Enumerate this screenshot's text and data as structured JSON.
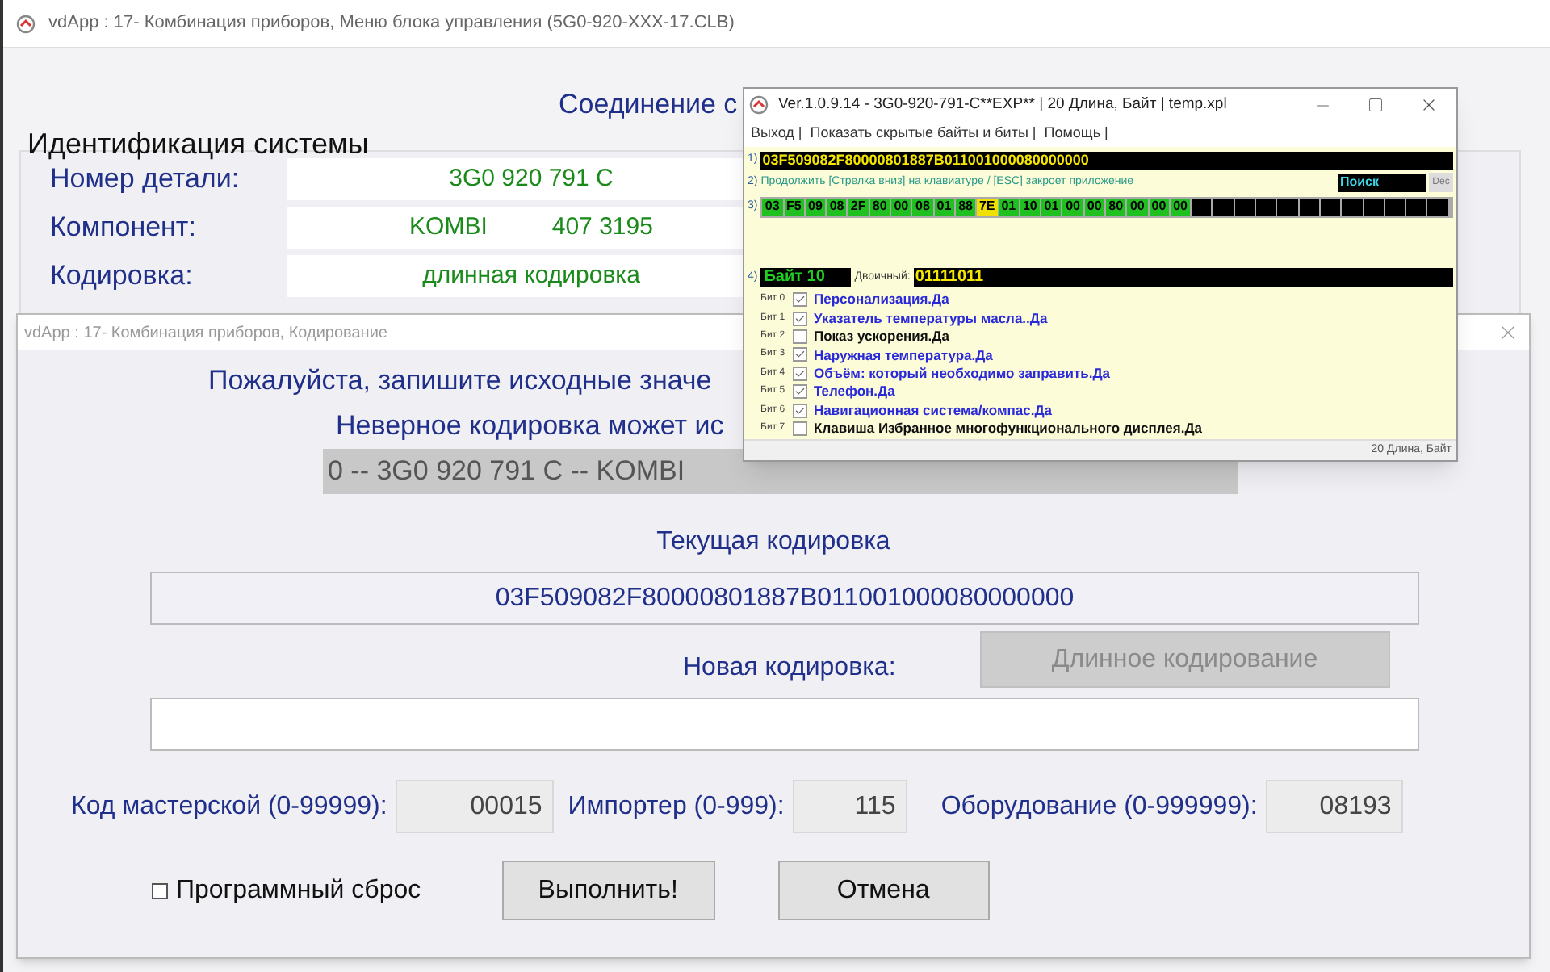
{
  "main_window": {
    "title": "vdApp : 17- Комбинация приборов,  Меню блока управления (5G0-920-XXX-17.CLB)",
    "connection_label": "Соединение с",
    "group_title": "Идентификация системы",
    "fields": [
      {
        "label": "Номер детали:",
        "values": [
          "3G0 920 791 C"
        ]
      },
      {
        "label": "Компонент:",
        "values": [
          "KOMBI",
          "407 3195"
        ]
      },
      {
        "label": "Кодировка:",
        "values": [
          "длинная кодировка"
        ]
      }
    ]
  },
  "coding_dialog": {
    "title": "vdApp : 17- Комбинация приборов,  Кодирование",
    "warning_1": "Пожалуйста, запишите исходные значе",
    "warning_2": "Неверное кодировка может ис",
    "identity": "0 -- 3G0 920 791 C -- KOMBI",
    "current_label": "Текущая кодировка",
    "current_value": "03F509082F80000801887B011001000080000000",
    "new_label": "Новая кодировка:",
    "long_button": {
      "label": "Длинное кодирование",
      "disabled": true
    },
    "params": [
      {
        "label": "Код мастерской (0-99999):",
        "value": "00015"
      },
      {
        "label": "Импортер (0-999):",
        "value": "115"
      },
      {
        "label": "Оборудование (0-999999):",
        "value": "08193"
      }
    ],
    "soft_reset": {
      "label": "Программный сброс",
      "checked": false
    },
    "execute_button": "Выполнить!",
    "cancel_button": "Отмена"
  },
  "byte_editor": {
    "title": "Ver.1.0.9.14 -    3G0-920-791-C**EXP** | 20 Длина, Байт | temp.xpl",
    "menu": [
      "Выход |",
      "Показать скрытые байты и биты |",
      "Помощь |"
    ],
    "row_1_label": "1)",
    "coding": "03F509082F80000801887B011001000080000000",
    "row_2_label": "2)",
    "hint": "Продолжить [Стрелка вниз] на клавиатуре / [ESC] закроет приложение",
    "search": "Поиск",
    "dec_button": "Dec",
    "row_3_label": "3)",
    "bytes": [
      {
        "value": "03",
        "selected": false
      },
      {
        "value": "F5",
        "selected": false
      },
      {
        "value": "09",
        "selected": false
      },
      {
        "value": "08",
        "selected": false
      },
      {
        "value": "2F",
        "selected": false
      },
      {
        "value": "80",
        "selected": false
      },
      {
        "value": "00",
        "selected": false
      },
      {
        "value": "08",
        "selected": false
      },
      {
        "value": "01",
        "selected": false
      },
      {
        "value": "88",
        "selected": false
      },
      {
        "value": "7E",
        "selected": true
      },
      {
        "value": "01",
        "selected": false
      },
      {
        "value": "10",
        "selected": false
      },
      {
        "value": "01",
        "selected": false
      },
      {
        "value": "00",
        "selected": false
      },
      {
        "value": "00",
        "selected": false
      },
      {
        "value": "80",
        "selected": false
      },
      {
        "value": "00",
        "selected": false
      },
      {
        "value": "00",
        "selected": false
      },
      {
        "value": "00",
        "selected": false
      }
    ],
    "row_4_label": "4)",
    "byte_label": "Байт 10",
    "binary_label": "Двоичный:",
    "binary": "01111011",
    "bits": [
      {
        "label": "Бит 0",
        "text": "Персонализация.Да",
        "checked": true
      },
      {
        "label": "Бит 1",
        "text": "Указатель температуры масла..Да",
        "checked": true
      },
      {
        "label": "Бит 2",
        "text": "Показ ускорения.Да",
        "checked": false
      },
      {
        "label": "Бит 3",
        "text": "Наружная температура.Да",
        "checked": true
      },
      {
        "label": "Бит 4",
        "text": "Объём: который необходимо заправить.Да",
        "checked": true
      },
      {
        "label": "Бит 5",
        "text": "Телефон.Да",
        "checked": true
      },
      {
        "label": "Бит 6",
        "text": "Навигационная система/компас.Да",
        "checked": true
      },
      {
        "label": "Бит 7",
        "text": "Клавиша Избранное многофункционального дисплея.Да",
        "checked": false
      }
    ],
    "status": "20 Длина, Байт"
  }
}
